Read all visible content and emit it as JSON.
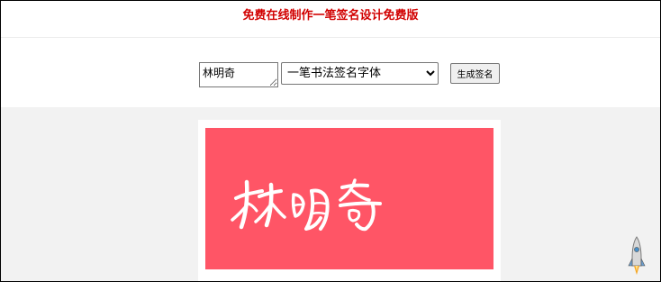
{
  "header": {
    "title": "免费在线制作一笔签名设计免费版"
  },
  "form": {
    "name_value": "林明奇",
    "font_select": {
      "selected": "一笔书法签名字体",
      "options": [
        "一笔书法签名字体"
      ]
    },
    "generate_label": "生成签名"
  },
  "result": {
    "signature_text": "林明奇",
    "canvas_color": "#ff5566",
    "ink_color": "#ffffff"
  },
  "icons": {
    "back_to_top": "rocket-icon"
  },
  "colors": {
    "title": "#d10000",
    "result_background": "#f2f2f2"
  }
}
